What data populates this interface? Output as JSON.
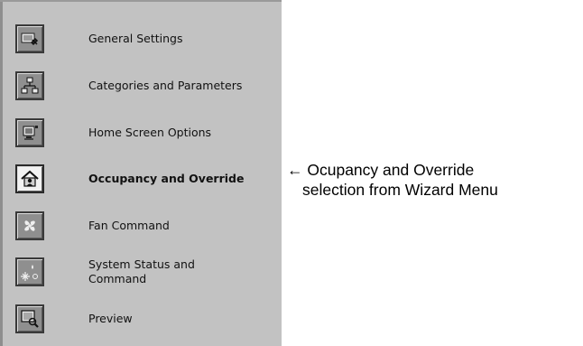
{
  "wizard_menu": {
    "items": [
      {
        "label": "General Settings",
        "icon": "general-settings-icon",
        "active": false
      },
      {
        "label": "Categories and Parameters",
        "icon": "categories-parameters-icon",
        "active": false
      },
      {
        "label": "Home Screen Options",
        "icon": "home-screen-options-icon",
        "active": false
      },
      {
        "label": "Occupancy and Override",
        "icon": "occupancy-override-icon",
        "active": true
      },
      {
        "label": "Fan Command",
        "icon": "fan-command-icon",
        "active": false
      },
      {
        "label": "System Status and\nCommand",
        "icon": "system-status-icon",
        "active": false
      },
      {
        "label": "Preview",
        "icon": "preview-icon",
        "active": false
      }
    ]
  },
  "annotation": {
    "line1": "← Ocupancy and Override",
    "line2": "selection from Wizard Menu"
  },
  "colors": {
    "panel_bg": "#c2c2c2",
    "icon_bg": "#8f8f8f",
    "active_icon_bg": "#f2f2f2"
  }
}
